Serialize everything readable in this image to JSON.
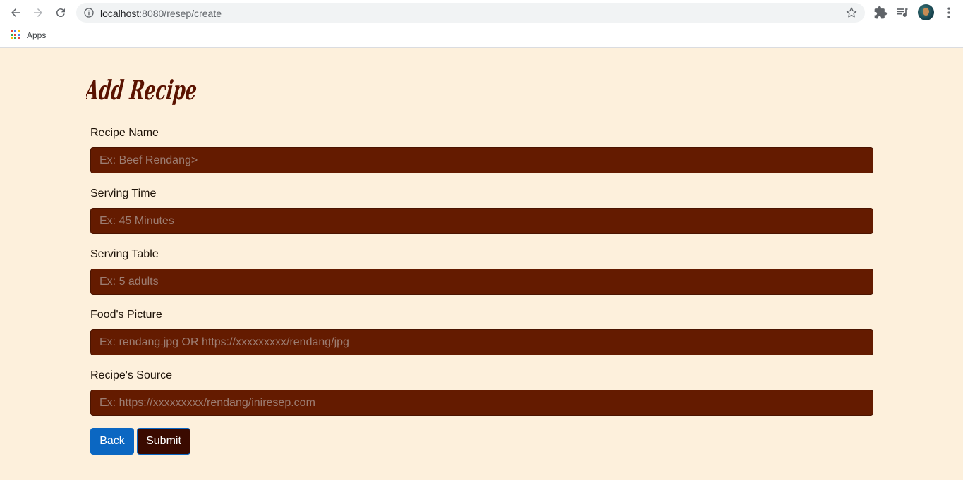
{
  "browser": {
    "url_host": "localhost",
    "url_rest": ":8080/resep/create",
    "bookmarks": {
      "apps_label": "Apps"
    }
  },
  "page": {
    "title": "Add Recipe",
    "fields": [
      {
        "label": "Recipe Name",
        "placeholder": "Ex: Beef Rendang>"
      },
      {
        "label": "Serving Time",
        "placeholder": "Ex: 45 Minutes"
      },
      {
        "label": "Serving Table",
        "placeholder": "Ex: 5 adults"
      },
      {
        "label": "Food's Picture",
        "placeholder": "Ex: rendang.jpg OR https://xxxxxxxxx/rendang/jpg"
      },
      {
        "label": "Recipe's Source",
        "placeholder": "Ex: https://xxxxxxxxx/rendang/iniresep.com"
      }
    ],
    "buttons": {
      "back_label": "Back",
      "submit_label": "Submit"
    }
  },
  "colors": {
    "page_background": "#fdf0dc",
    "input_background": "#641b00",
    "title_color": "#5a1200",
    "back_button": "#0b67c2",
    "submit_button": "#3a0a00"
  },
  "icons": [
    "back-arrow-icon",
    "forward-arrow-icon",
    "reload-icon",
    "site-info-icon",
    "bookmark-star-icon",
    "extensions-puzzle-icon",
    "media-queue-icon",
    "profile-avatar",
    "more-vert-icon",
    "apps-grid-icon"
  ]
}
